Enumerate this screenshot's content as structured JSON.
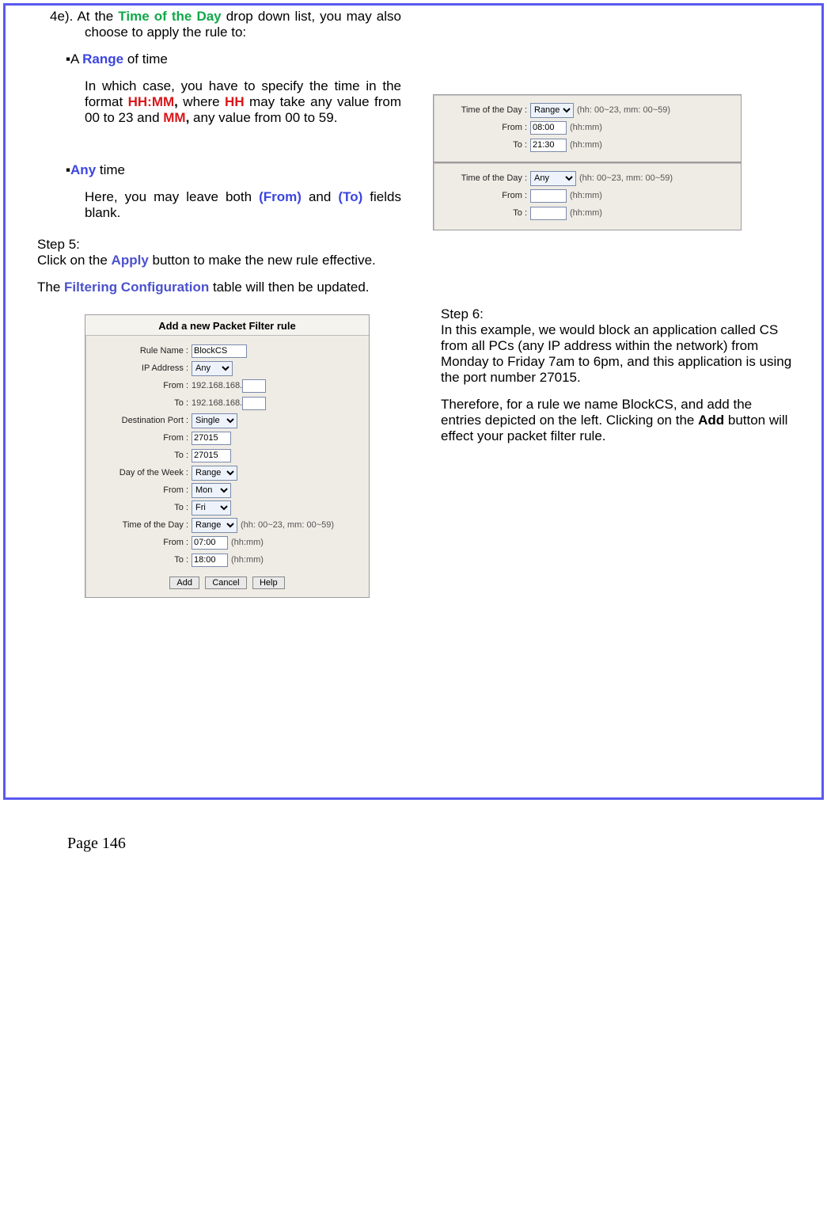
{
  "p4e_label": "4e).",
  "p4e_t1": "At the ",
  "p4e_green": "Time of the Day",
  "p4e_t2": " drop down list, you may also choose to apply the rule to:",
  "bullet1_dot": "▪",
  "bullet1_pre": "A ",
  "bullet1_term": "Range",
  "bullet1_post": " of time",
  "bullet1_body_a": "In which case, you have to specify the time in the format ",
  "bullet1_hhmm": "HH:MM",
  "bullet1_comma": ",",
  "bullet1_body_b": " where ",
  "bullet1_hh": "HH",
  "bullet1_body_c": " may take any value from 00 to 23 and ",
  "bullet1_mm": "MM",
  "bullet1_comma2": ",",
  "bullet1_body_d": " any value from 00 to 59.",
  "bullet2_dot": "▪",
  "bullet2_term": "Any",
  "bullet2_post": " time",
  "bullet2_body_a": "Here, you may leave both ",
  "bullet2_from": "(From)",
  "bullet2_body_b": " and ",
  "bullet2_to": "(To)",
  "bullet2_body_c": " fields blank.",
  "step5_label": "Step 5:",
  "step5_t1": "Click on the ",
  "step5_apply": "Apply",
  "step5_t2": " button to make the new rule effective.",
  "step5b_t1": "The ",
  "step5b_term": "Filtering Configuration",
  "step5b_t2": " table will then be updated.",
  "fig1": {
    "lab_tod": "Time of the Day :",
    "sel": "Range",
    "hint": "(hh: 00~23, mm: 00~59)",
    "lab_from": "From :",
    "val_from": "08:00",
    "hhmm": "(hh:mm)",
    "lab_to": "To :",
    "val_to": "21:30"
  },
  "fig2": {
    "lab_tod": "Time of the Day :",
    "sel": "Any",
    "hint": "(hh: 00~23, mm: 00~59)",
    "lab_from": "From :",
    "hhmm": "(hh:mm)",
    "lab_to": "To :"
  },
  "fig3": {
    "title": "Add a new Packet Filter rule",
    "lab_rule": "Rule Name :",
    "val_rule": "BlockCS",
    "lab_ip": "IP Address :",
    "sel_ip": "Any",
    "lab_from": "From :",
    "lab_to": "To :",
    "ip_prefix": "192.168.168.",
    "lab_dport": "Destination Port :",
    "sel_dport": "Single",
    "val_port": "27015",
    "lab_dow": "Day of the Week :",
    "sel_dow": "Range",
    "sel_mon": "Mon",
    "sel_fri": "Fri",
    "lab_tod": "Time of the Day :",
    "sel_tod": "Range",
    "hint": "(hh: 00~23, mm: 00~59)",
    "val_tfrom": "07:00",
    "val_tto": "18:00",
    "hhmm": "(hh:mm)",
    "btn_add": "Add",
    "btn_cancel": "Cancel",
    "btn_help": "Help"
  },
  "step6_label": "Step 6:",
  "step6_p1": "In this example, we would block an application called CS from all PCs (any IP address within the network) from Monday to Friday 7am to 6pm, and this application is using the port number 27015.",
  "step6_p2a": "Therefore, for a rule we name BlockCS, and add the entries depicted on the left. Clicking on the ",
  "step6_add": "Add",
  "step6_p2b": " button will effect your packet filter rule.",
  "footer": "Page 146"
}
